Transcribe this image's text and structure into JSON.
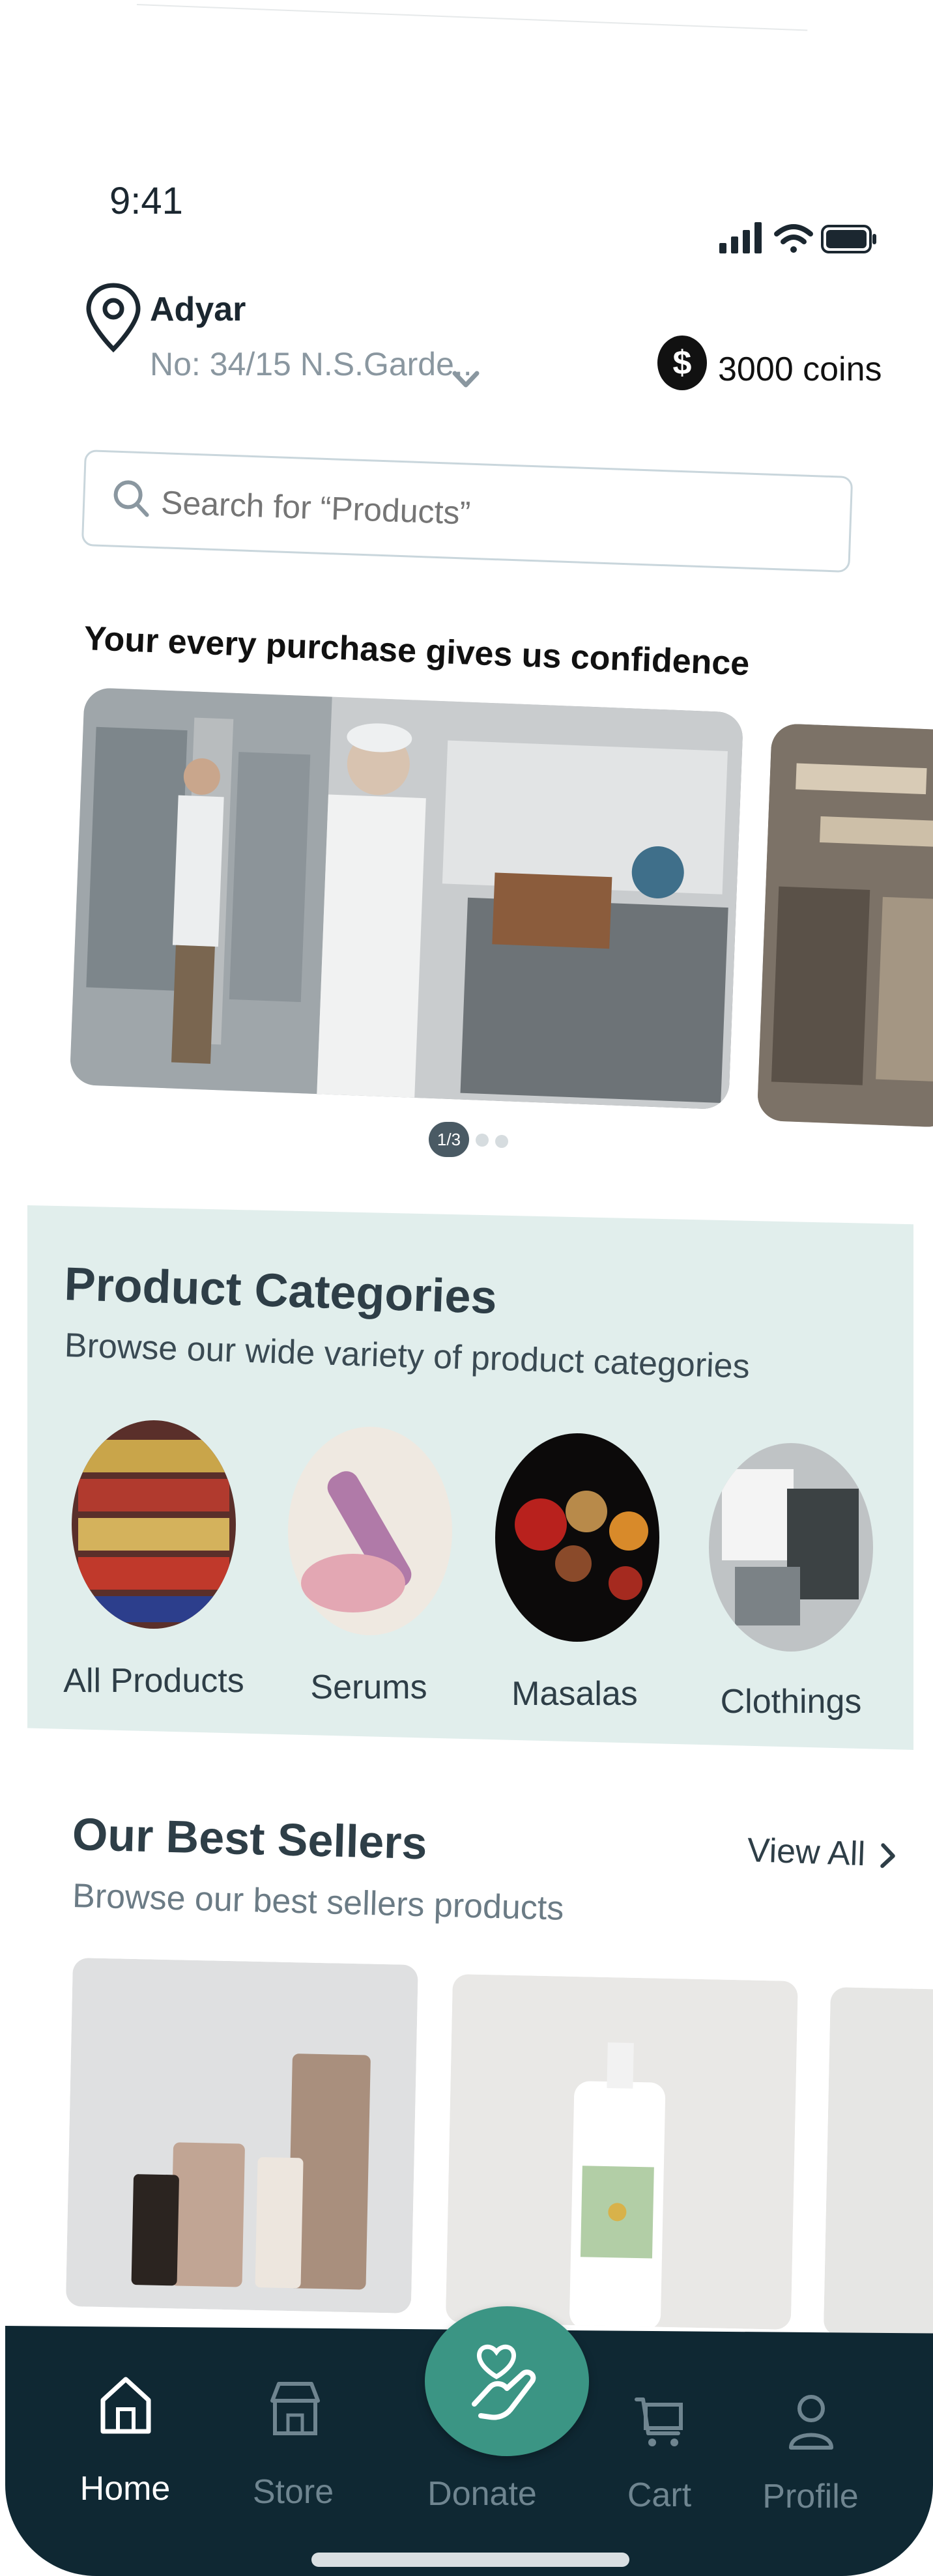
{
  "status": {
    "time": "9:41"
  },
  "location": {
    "city": "Adyar",
    "address": "No: 34/15 N.S.Garde..."
  },
  "coins": {
    "label": "3000 coins"
  },
  "search": {
    "placeholder": "Search for “Products”"
  },
  "promo": {
    "title": "Your every purchase gives us confidence",
    "pager": "1/3"
  },
  "categories": {
    "title": "Product Categories",
    "subtitle": "Browse our wide variety of product categories",
    "items": [
      {
        "label": "All Products"
      },
      {
        "label": "Serums"
      },
      {
        "label": "Masalas"
      },
      {
        "label": "Clothings"
      }
    ]
  },
  "best_sellers": {
    "title": "Our Best Sellers",
    "subtitle": "Browse our best sellers products",
    "view_all": "View All"
  },
  "nav": {
    "items": [
      {
        "label": "Home",
        "icon": "home-icon",
        "active": true
      },
      {
        "label": "Store",
        "icon": "store-icon"
      },
      {
        "label": "Donate",
        "icon": "donate-icon"
      },
      {
        "label": "Cart",
        "icon": "cart-icon"
      },
      {
        "label": "Profile",
        "icon": "profile-icon"
      }
    ]
  },
  "colors": {
    "accent": "#3b9584",
    "nav_bg": "#0f2833",
    "category_bg": "#e1eeec",
    "text_dark": "#2e3e47"
  }
}
